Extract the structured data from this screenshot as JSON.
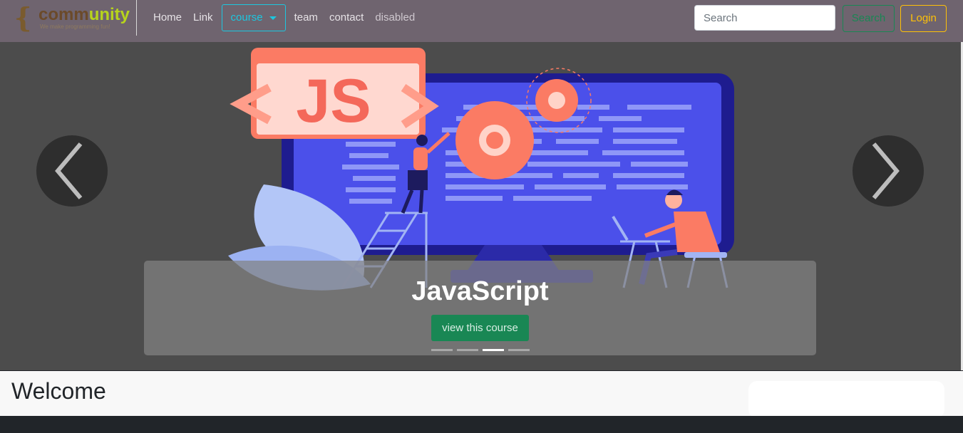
{
  "brand": {
    "name_part1": "comm",
    "name_part2": "unity",
    "tagline": "We make programming fun!"
  },
  "nav": {
    "items": [
      {
        "label": "Home"
      },
      {
        "label": "Link"
      },
      {
        "label": "course"
      },
      {
        "label": "team"
      },
      {
        "label": "contact"
      },
      {
        "label": "disabled"
      }
    ]
  },
  "search": {
    "placeholder": "Search",
    "button_label": "Search"
  },
  "login": {
    "label": "Login"
  },
  "carousel": {
    "caption_title": "JavaScript",
    "button_label": "view this course",
    "slide_count": 4,
    "active_slide": 3,
    "illustration_text": "JS"
  },
  "welcome": {
    "title": "Welcome"
  },
  "colors": {
    "navbar": "#6f646f",
    "accent_info": "#1cc7e0",
    "success": "#198754",
    "warning": "#ffc107",
    "dark": "#212529"
  },
  "icons": {
    "prev": "chevron-left-icon",
    "next": "chevron-right-icon",
    "dropdown": "caret-down-icon"
  }
}
